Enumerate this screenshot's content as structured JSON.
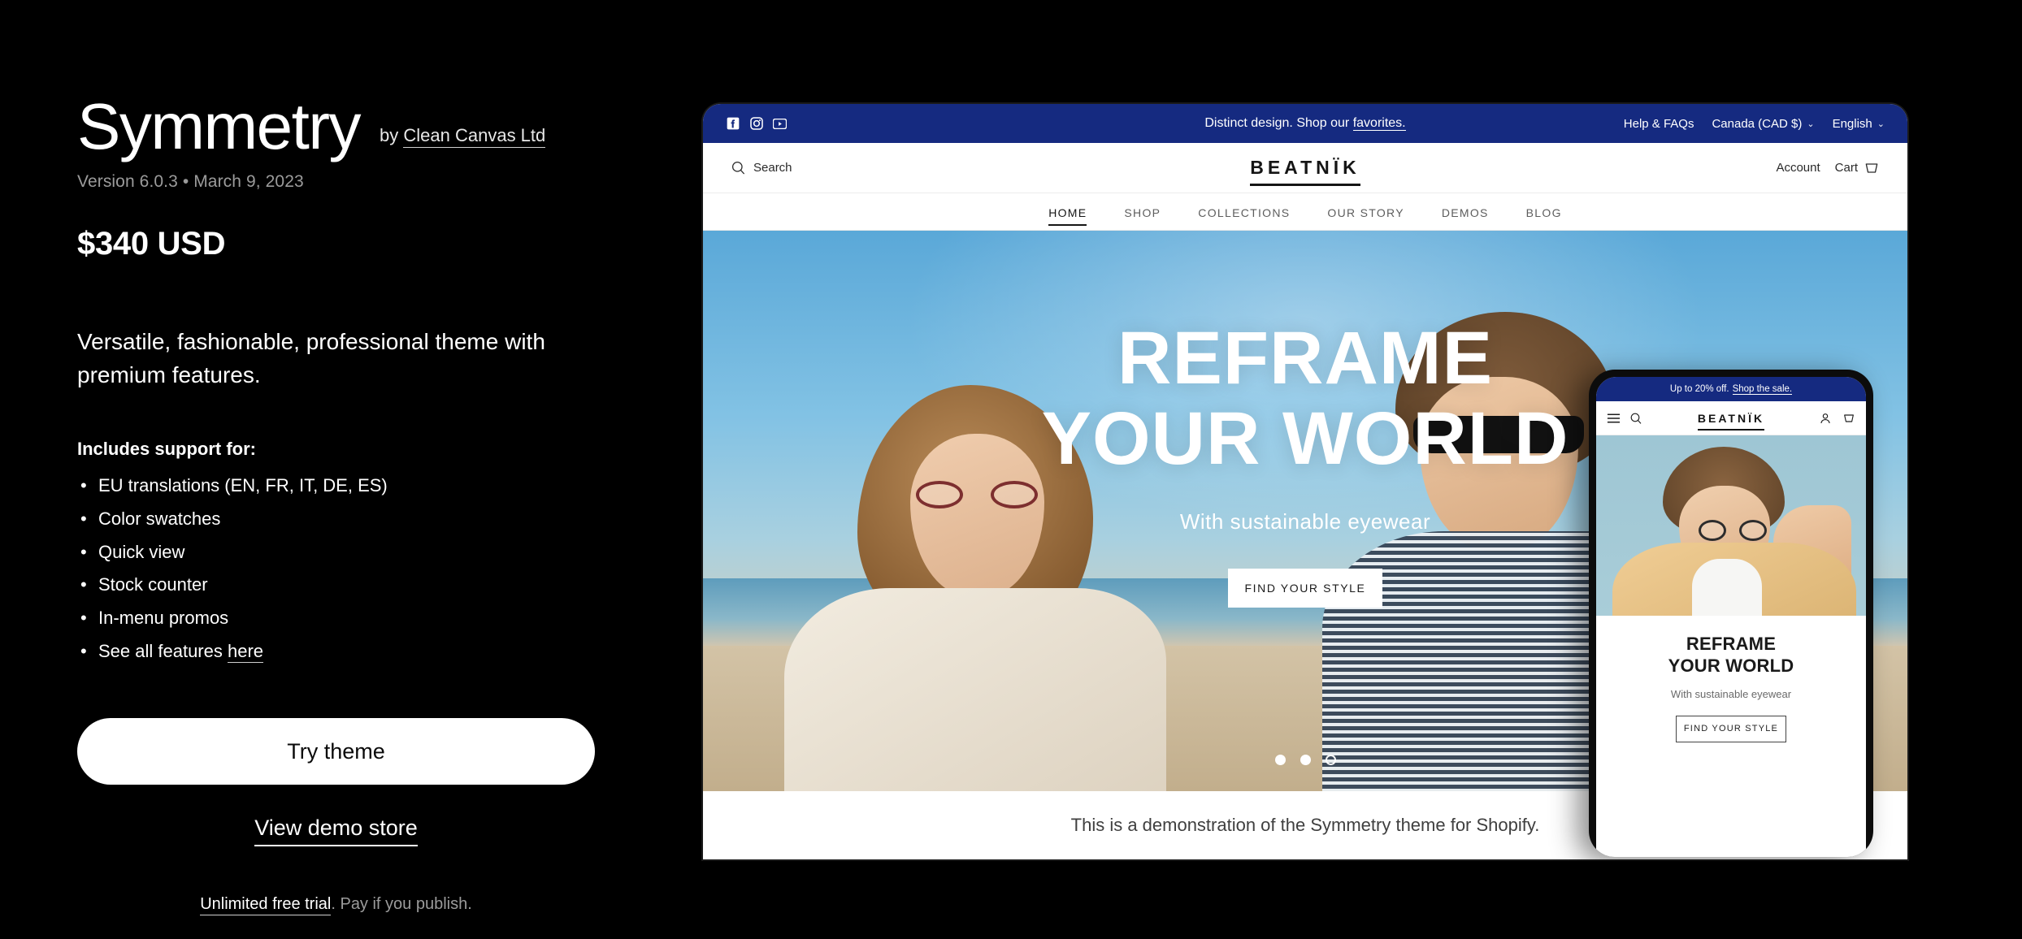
{
  "theme": {
    "title": "Symmetry",
    "by_prefix": "by",
    "vendor": "Clean Canvas Ltd",
    "version_line": "Version 6.0.3 • March 9, 2023",
    "price": "$340 USD",
    "description": "Versatile, fashionable, professional theme with premium features.",
    "includes_heading": "Includes support for:",
    "features": [
      {
        "text": "EU translations (EN, FR, IT, DE, ES)",
        "link": ""
      },
      {
        "text": "Color swatches",
        "link": ""
      },
      {
        "text": "Quick view",
        "link": ""
      },
      {
        "text": "Stock counter",
        "link": ""
      },
      {
        "text": "In-menu promos",
        "link": ""
      },
      {
        "text": "See all features ",
        "link": "here"
      }
    ],
    "try_button": "Try theme",
    "demo_link": "View demo store",
    "trial_link": "Unlimited free trial",
    "trial_rest": ". Pay if you publish."
  },
  "preview": {
    "announcement": {
      "text_before": "Distinct design. Shop our ",
      "link": "favorites.",
      "socials": [
        "facebook-icon",
        "instagram-icon",
        "youtube-icon"
      ],
      "help": "Help & FAQs",
      "currency": "Canada (CAD $)",
      "language": "English",
      "chevron": "⌄",
      "bg_color": "#152a80"
    },
    "header": {
      "search_label": "Search",
      "brand": "BEATNÏK",
      "account_label": "Account",
      "cart_label": "Cart"
    },
    "nav": [
      {
        "label": "HOME",
        "active": true
      },
      {
        "label": "SHOP",
        "active": false
      },
      {
        "label": "COLLECTIONS",
        "active": false
      },
      {
        "label": "OUR STORY",
        "active": false
      },
      {
        "label": "DEMOS",
        "active": false
      },
      {
        "label": "BLOG",
        "active": false
      }
    ],
    "hero": {
      "line1": "REFRAME",
      "line2": "YOUR WORLD",
      "subtitle": "With sustainable eyewear",
      "cta": "FIND YOUR STYLE",
      "dots": [
        true,
        true,
        false
      ]
    },
    "caption": "This is a demonstration of the Symmetry theme for Shopify."
  },
  "phone": {
    "announcement_before": "Up to 20% off.",
    "announcement_link": "Shop the sale.",
    "brand": "BEATNÏK",
    "hero": {
      "line1": "REFRAME",
      "line2": "YOUR WORLD",
      "subtitle": "With sustainable eyewear",
      "cta": "FIND YOUR STYLE"
    }
  }
}
